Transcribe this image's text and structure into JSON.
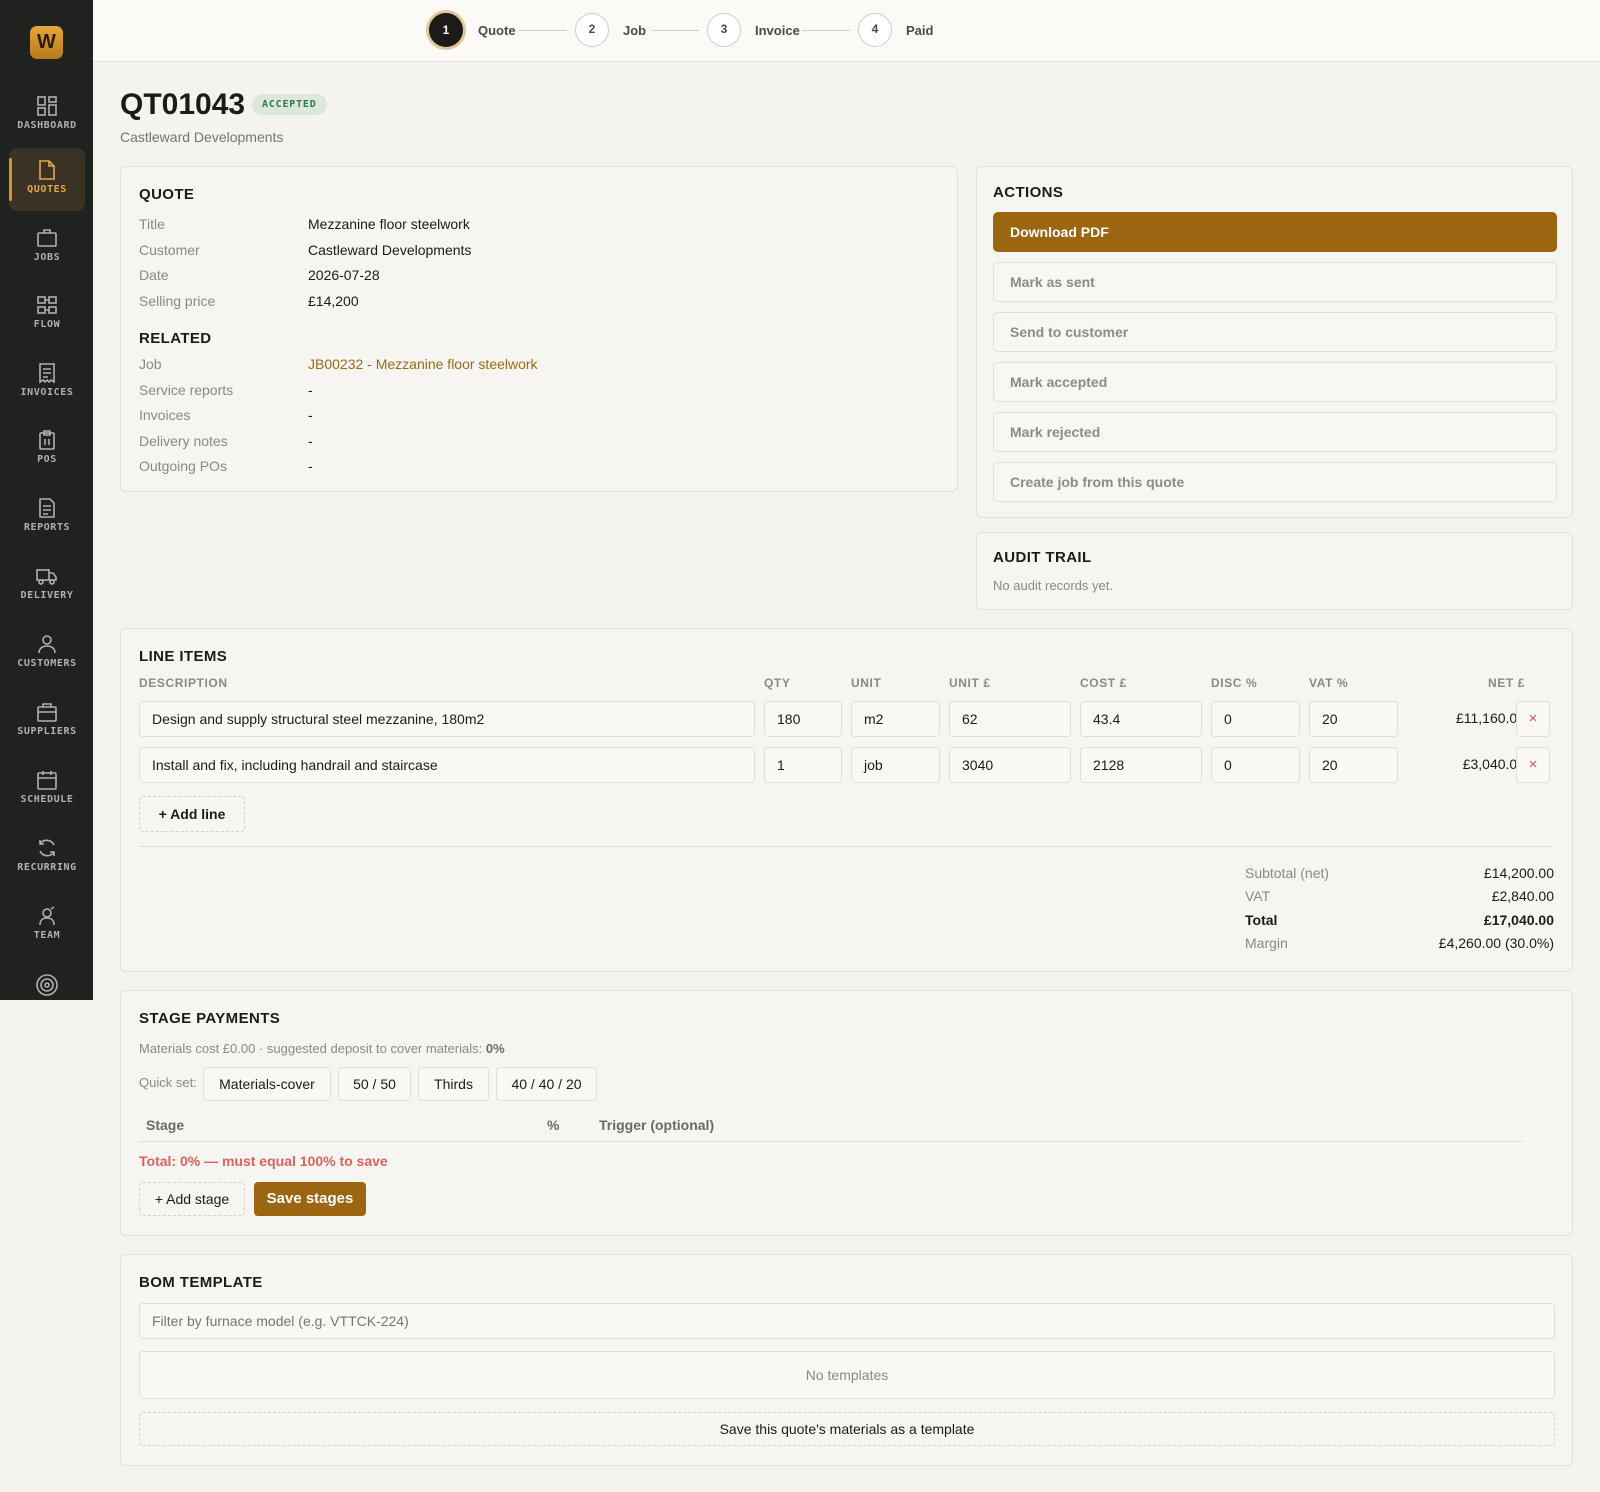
{
  "sidebar": {
    "logo": "W",
    "items": [
      {
        "label": "DASHBOARD",
        "icon": "grid-icon",
        "active": false
      },
      {
        "label": "QUOTES",
        "icon": "document-icon",
        "active": true
      },
      {
        "label": "JOBS",
        "icon": "briefcase-icon",
        "active": false
      },
      {
        "label": "FLOW",
        "icon": "flow-icon",
        "active": false
      },
      {
        "label": "INVOICES",
        "icon": "receipt-icon",
        "active": false
      },
      {
        "label": "POS",
        "icon": "clipboard-icon",
        "active": false
      },
      {
        "label": "REPORTS",
        "icon": "report-icon",
        "active": false
      },
      {
        "label": "DELIVERY",
        "icon": "truck-icon",
        "active": false
      },
      {
        "label": "CUSTOMERS",
        "icon": "user-icon",
        "active": false
      },
      {
        "label": "SUPPLIERS",
        "icon": "package-icon",
        "active": false
      },
      {
        "label": "SCHEDULE",
        "icon": "calendar-icon",
        "active": false
      },
      {
        "label": "RECURRING",
        "icon": "refresh-icon",
        "active": false
      },
      {
        "label": "TEAM",
        "icon": "team-icon",
        "active": false
      }
    ]
  },
  "stepper": {
    "steps": [
      {
        "number": "1",
        "label": "Quote"
      },
      {
        "number": "2",
        "label": "Job"
      },
      {
        "number": "3",
        "label": "Invoice"
      },
      {
        "number": "4",
        "label": "Paid"
      }
    ],
    "current": 1
  },
  "header": {
    "title": "QT01043",
    "status": "ACCEPTED",
    "subtitle": "Castleward Developments"
  },
  "quote": {
    "heading": "QUOTE",
    "fields": [
      {
        "key": "Title",
        "value": "Mezzanine floor steelwork"
      },
      {
        "key": "Customer",
        "value": "Castleward Developments"
      },
      {
        "key": "Date",
        "value": "2026-07-28"
      },
      {
        "key": "Selling price",
        "value": "£14,200"
      }
    ],
    "related_heading": "RELATED",
    "related": [
      {
        "key": "Job",
        "value": "JB00232 - Mezzanine floor steelwork"
      },
      {
        "key": "Service reports",
        "value": "-"
      },
      {
        "key": "Invoices",
        "value": "-"
      },
      {
        "key": "Delivery notes",
        "value": "-"
      },
      {
        "key": "Outgoing POs",
        "value": "-"
      }
    ]
  },
  "actions": {
    "heading": "ACTIONS",
    "buttons": [
      "Download PDF",
      "Mark as sent",
      "Send to customer",
      "Mark accepted",
      "Mark rejected",
      "Create job from this quote"
    ]
  },
  "audit": {
    "heading": "AUDIT TRAIL",
    "empty": "No audit records yet."
  },
  "line_items": {
    "heading": "LINE ITEMS",
    "columns": [
      "DESCRIPTION",
      "QTY",
      "UNIT",
      "UNIT £",
      "COST £",
      "DISC %",
      "VAT %",
      "NET £"
    ],
    "rows": [
      {
        "description": "Design and supply structural steel mezzanine, 180m2",
        "qty": "180",
        "unit": "m2",
        "unit_price": "62",
        "cost": "43.4",
        "disc": "0",
        "vat": "20",
        "net": "£11,160.00"
      },
      {
        "description": "Install and fix, including handrail and staircase",
        "qty": "1",
        "unit": "job",
        "unit_price": "3040",
        "cost": "2128",
        "disc": "0",
        "vat": "20",
        "net": "£3,040.00"
      }
    ],
    "delete_symbol": "×",
    "add_line": "+ Add line",
    "totals": [
      {
        "key": "Subtotal (net)",
        "value": "£14,200.00"
      },
      {
        "key": "VAT",
        "value": "£2,840.00"
      },
      {
        "key": "Total",
        "value": "£17,040.00"
      },
      {
        "key": "Margin",
        "value": "£4,260.00 (30.0%)"
      }
    ]
  },
  "stage_payments": {
    "heading": "STAGE PAYMENTS",
    "note_prefix": "Materials cost £0.00 · suggested deposit to cover materials: ",
    "note_value": "0%",
    "quick_set_label": "Quick set:",
    "presets": [
      "Materials-cover",
      "50 / 50",
      "Thirds",
      "40 / 40 / 20"
    ],
    "columns": [
      "Stage",
      "%",
      "Trigger (optional)"
    ],
    "error": "Total: 0% — must equal 100% to save",
    "add_stage": "+ Add stage",
    "save": "Save stages"
  },
  "bom": {
    "heading": "BOM TEMPLATE",
    "filter_placeholder": "Filter by furnace model (e.g. VTTCK-224)",
    "empty": "No templates",
    "save_template": "Save this quote's materials as a template"
  },
  "colors": {
    "accent": "#9b6512",
    "sidebar": "#1f221f",
    "success": "#2f7a43",
    "danger": "#e0605c"
  }
}
